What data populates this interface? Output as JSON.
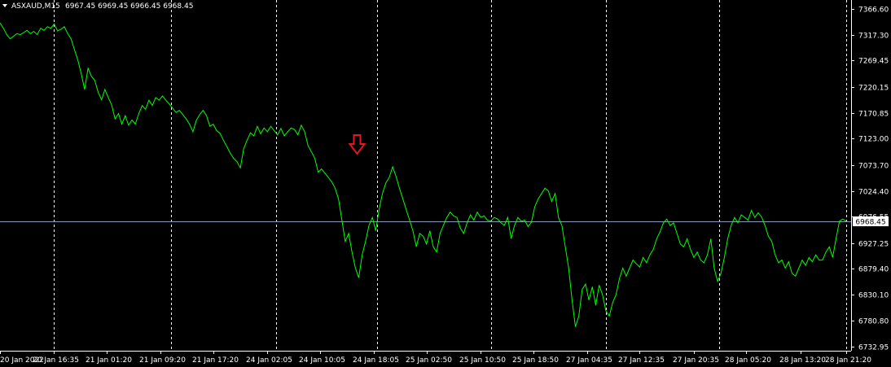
{
  "header": {
    "symbol_label": "ASXAUD,M15",
    "ohlc_label": "6967.45 6969.45 6966.45 6968.45"
  },
  "colors": {
    "background": "#000000",
    "price_line": "#00ff00",
    "current_price_line": "#8899bb",
    "grid_dashed": "#ffffff",
    "axis_text": "#ffffff",
    "arrow": "#e8141e"
  },
  "chart_data": {
    "type": "line",
    "title": "",
    "current_price": 6968.45,
    "current_price_label": "6968.45",
    "ylim": [
      6725.0,
      7383.0
    ],
    "y_ticks": [
      7366.6,
      7317.3,
      7269.45,
      7220.15,
      7170.85,
      7123.0,
      7073.7,
      7024.4,
      6976.55,
      6927.25,
      6879.4,
      6830.1,
      6780.8,
      6732.95
    ],
    "y_tick_labels": [
      "7366.60",
      "7317.30",
      "7269.45",
      "7220.15",
      "7170.85",
      "7123.00",
      "7073.70",
      "7024.40",
      "6976.55",
      "6927.25",
      "6879.40",
      "6830.10",
      "6780.80",
      "6732.95"
    ],
    "x_tick_labels": [
      "20 Jan 2022",
      "20 Jan 16:35",
      "21 Jan 01:20",
      "21 Jan 09:20",
      "21 Jan 17:20",
      "24 Jan 02:05",
      "24 Jan 10:05",
      "24 Jan 18:05",
      "25 Jan 02:50",
      "25 Jan 10:50",
      "25 Jan 18:50",
      "27 Jan 04:35",
      "27 Jan 12:35",
      "27 Jan 20:35",
      "28 Jan 05:20",
      "28 Jan 13:20",
      "28 Jan 21:20"
    ],
    "x_tick_bar": [
      0,
      32,
      63,
      95,
      126,
      158,
      189,
      221,
      252,
      284,
      315,
      347,
      378,
      410,
      441,
      473,
      500
    ],
    "session_breaks_bar": [
      32,
      101,
      163,
      223,
      290,
      358,
      425,
      500
    ],
    "signal_arrow": {
      "bar": 211,
      "direction": "down"
    },
    "series": [
      {
        "values": [
          [
            0,
            7340
          ],
          [
            2,
            7330
          ],
          [
            4,
            7318
          ],
          [
            6,
            7310
          ],
          [
            8,
            7315
          ],
          [
            10,
            7320
          ],
          [
            12,
            7318
          ],
          [
            14,
            7322
          ],
          [
            16,
            7326
          ],
          [
            18,
            7320
          ],
          [
            20,
            7324
          ],
          [
            22,
            7318
          ],
          [
            24,
            7330
          ],
          [
            26,
            7326
          ],
          [
            28,
            7333
          ],
          [
            30,
            7330
          ],
          [
            32,
            7338
          ],
          [
            34,
            7325
          ],
          [
            36,
            7328
          ],
          [
            38,
            7333
          ],
          [
            40,
            7320
          ],
          [
            42,
            7310
          ],
          [
            44,
            7290
          ],
          [
            46,
            7270
          ],
          [
            48,
            7245
          ],
          [
            50,
            7215
          ],
          [
            52,
            7255
          ],
          [
            54,
            7240
          ],
          [
            56,
            7232
          ],
          [
            58,
            7210
          ],
          [
            60,
            7196
          ],
          [
            62,
            7215
          ],
          [
            64,
            7200
          ],
          [
            66,
            7186
          ],
          [
            68,
            7160
          ],
          [
            70,
            7170
          ],
          [
            72,
            7150
          ],
          [
            74,
            7166
          ],
          [
            76,
            7148
          ],
          [
            78,
            7158
          ],
          [
            80,
            7150
          ],
          [
            82,
            7170
          ],
          [
            84,
            7185
          ],
          [
            86,
            7178
          ],
          [
            88,
            7195
          ],
          [
            90,
            7185
          ],
          [
            92,
            7200
          ],
          [
            94,
            7195
          ],
          [
            96,
            7203
          ],
          [
            98,
            7195
          ],
          [
            100,
            7188
          ],
          [
            102,
            7180
          ],
          [
            104,
            7172
          ],
          [
            106,
            7176
          ],
          [
            108,
            7168
          ],
          [
            110,
            7160
          ],
          [
            112,
            7150
          ],
          [
            114,
            7136
          ],
          [
            116,
            7157
          ],
          [
            118,
            7168
          ],
          [
            120,
            7176
          ],
          [
            122,
            7166
          ],
          [
            124,
            7146
          ],
          [
            126,
            7150
          ],
          [
            128,
            7138
          ],
          [
            130,
            7133
          ],
          [
            132,
            7120
          ],
          [
            134,
            7108
          ],
          [
            136,
            7096
          ],
          [
            138,
            7086
          ],
          [
            140,
            7080
          ],
          [
            142,
            7068
          ],
          [
            144,
            7104
          ],
          [
            146,
            7120
          ],
          [
            148,
            7134
          ],
          [
            150,
            7128
          ],
          [
            152,
            7146
          ],
          [
            154,
            7132
          ],
          [
            156,
            7143
          ],
          [
            158,
            7136
          ],
          [
            160,
            7146
          ],
          [
            162,
            7138
          ],
          [
            164,
            7130
          ],
          [
            166,
            7142
          ],
          [
            168,
            7128
          ],
          [
            170,
            7136
          ],
          [
            172,
            7143
          ],
          [
            174,
            7140
          ],
          [
            176,
            7130
          ],
          [
            178,
            7148
          ],
          [
            180,
            7136
          ],
          [
            182,
            7110
          ],
          [
            184,
            7098
          ],
          [
            186,
            7086
          ],
          [
            188,
            7060
          ],
          [
            190,
            7066
          ],
          [
            192,
            7058
          ],
          [
            194,
            7050
          ],
          [
            196,
            7042
          ],
          [
            198,
            7030
          ],
          [
            200,
            7010
          ],
          [
            202,
            6970
          ],
          [
            204,
            6930
          ],
          [
            206,
            6945
          ],
          [
            208,
            6910
          ],
          [
            210,
            6880
          ],
          [
            212,
            6862
          ],
          [
            214,
            6905
          ],
          [
            216,
            6930
          ],
          [
            218,
            6960
          ],
          [
            220,
            6975
          ],
          [
            222,
            6950
          ],
          [
            224,
            6990
          ],
          [
            226,
            7020
          ],
          [
            228,
            7040
          ],
          [
            230,
            7050
          ],
          [
            232,
            7070
          ],
          [
            234,
            7052
          ],
          [
            236,
            7030
          ],
          [
            238,
            7010
          ],
          [
            240,
            6990
          ],
          [
            242,
            6970
          ],
          [
            244,
            6950
          ],
          [
            246,
            6920
          ],
          [
            248,
            6945
          ],
          [
            250,
            6940
          ],
          [
            252,
            6925
          ],
          [
            254,
            6950
          ],
          [
            256,
            6920
          ],
          [
            258,
            6910
          ],
          [
            260,
            6945
          ],
          [
            262,
            6960
          ],
          [
            264,
            6975
          ],
          [
            266,
            6985
          ],
          [
            268,
            6978
          ],
          [
            270,
            6975
          ],
          [
            272,
            6955
          ],
          [
            274,
            6945
          ],
          [
            276,
            6965
          ],
          [
            278,
            6980
          ],
          [
            280,
            6970
          ],
          [
            282,
            6985
          ],
          [
            284,
            6975
          ],
          [
            286,
            6978
          ],
          [
            288,
            6970
          ],
          [
            290,
            6968
          ],
          [
            292,
            6975
          ],
          [
            294,
            6972
          ],
          [
            296,
            6965
          ],
          [
            298,
            6960
          ],
          [
            300,
            6975
          ],
          [
            302,
            6935
          ],
          [
            304,
            6960
          ],
          [
            306,
            6975
          ],
          [
            308,
            6968
          ],
          [
            310,
            6970
          ],
          [
            312,
            6958
          ],
          [
            314,
            6966
          ],
          [
            316,
            6995
          ],
          [
            318,
            7010
          ],
          [
            320,
            7020
          ],
          [
            322,
            7030
          ],
          [
            324,
            7025
          ],
          [
            326,
            7005
          ],
          [
            328,
            7020
          ],
          [
            330,
            6975
          ],
          [
            332,
            6960
          ],
          [
            334,
            6920
          ],
          [
            336,
            6880
          ],
          [
            338,
            6820
          ],
          [
            340,
            6770
          ],
          [
            342,
            6790
          ],
          [
            344,
            6840
          ],
          [
            346,
            6850
          ],
          [
            348,
            6820
          ],
          [
            350,
            6845
          ],
          [
            352,
            6810
          ],
          [
            354,
            6848
          ],
          [
            356,
            6830
          ],
          [
            358,
            6800
          ],
          [
            360,
            6790
          ],
          [
            362,
            6815
          ],
          [
            364,
            6830
          ],
          [
            366,
            6860
          ],
          [
            368,
            6880
          ],
          [
            370,
            6865
          ],
          [
            372,
            6880
          ],
          [
            374,
            6895
          ],
          [
            376,
            6888
          ],
          [
            378,
            6882
          ],
          [
            380,
            6900
          ],
          [
            382,
            6890
          ],
          [
            384,
            6905
          ],
          [
            386,
            6915
          ],
          [
            388,
            6935
          ],
          [
            390,
            6948
          ],
          [
            392,
            6965
          ],
          [
            394,
            6972
          ],
          [
            396,
            6960
          ],
          [
            398,
            6965
          ],
          [
            400,
            6945
          ],
          [
            402,
            6925
          ],
          [
            404,
            6920
          ],
          [
            406,
            6935
          ],
          [
            408,
            6915
          ],
          [
            410,
            6900
          ],
          [
            412,
            6910
          ],
          [
            414,
            6895
          ],
          [
            416,
            6890
          ],
          [
            418,
            6905
          ],
          [
            420,
            6935
          ],
          [
            422,
            6880
          ],
          [
            424,
            6855
          ],
          [
            426,
            6870
          ],
          [
            428,
            6900
          ],
          [
            430,
            6935
          ],
          [
            432,
            6960
          ],
          [
            434,
            6975
          ],
          [
            436,
            6965
          ],
          [
            438,
            6980
          ],
          [
            440,
            6975
          ],
          [
            442,
            6970
          ],
          [
            444,
            6988
          ],
          [
            446,
            6975
          ],
          [
            448,
            6984
          ],
          [
            450,
            6976
          ],
          [
            452,
            6960
          ],
          [
            454,
            6940
          ],
          [
            456,
            6930
          ],
          [
            458,
            6905
          ],
          [
            460,
            6890
          ],
          [
            462,
            6895
          ],
          [
            464,
            6880
          ],
          [
            466,
            6892
          ],
          [
            468,
            6870
          ],
          [
            470,
            6865
          ],
          [
            472,
            6880
          ],
          [
            474,
            6895
          ],
          [
            476,
            6885
          ],
          [
            478,
            6900
          ],
          [
            480,
            6892
          ],
          [
            482,
            6905
          ],
          [
            484,
            6895
          ],
          [
            486,
            6895
          ],
          [
            488,
            6910
          ],
          [
            490,
            6920
          ],
          [
            492,
            6900
          ],
          [
            494,
            6935
          ],
          [
            496,
            6968
          ],
          [
            498,
            6972
          ],
          [
            500,
            6968
          ]
        ]
      }
    ]
  }
}
